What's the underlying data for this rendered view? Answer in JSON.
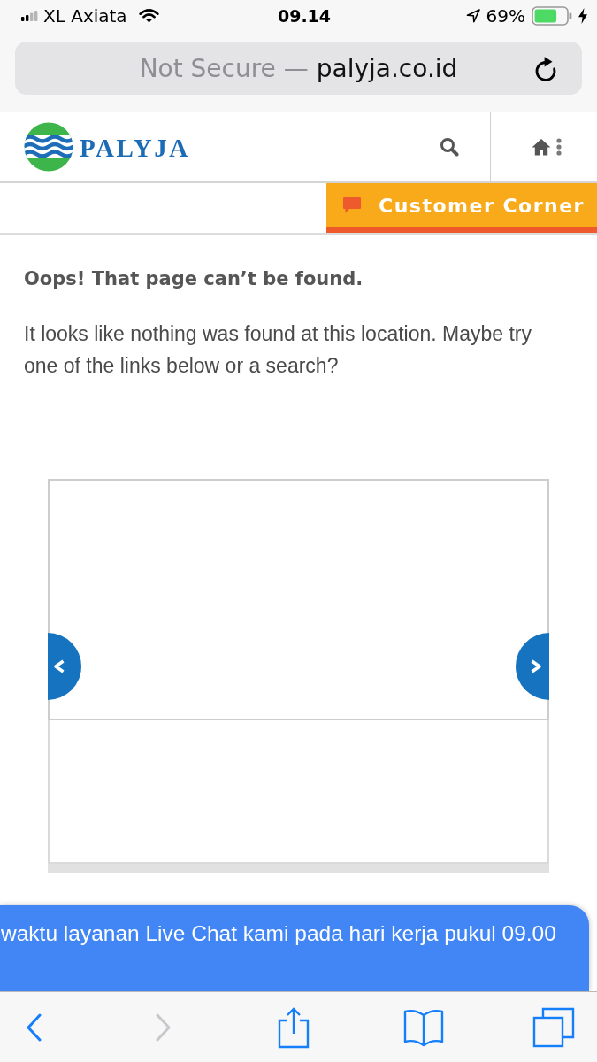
{
  "status_bar": {
    "carrier": "XL Axiata",
    "time": "09.14",
    "battery": "69%"
  },
  "address_bar": {
    "security": "Not Secure —",
    "domain": "palyja.co.id"
  },
  "site_header": {
    "logo_text": "PALYJA"
  },
  "customer_corner": {
    "label": "Customer Corner"
  },
  "error": {
    "title": "Oops! That page can’t be found.",
    "message": "It looks like nothing was found at this location. Maybe try one of the links below or a search?"
  },
  "live_chat": {
    "text": "waktu layanan Live Chat kami pada hari kerja pukul 09.00"
  },
  "toolbar": [
    {
      "kind": "back",
      "disabled": false
    },
    {
      "kind": "forward",
      "disabled": true
    },
    {
      "kind": "share",
      "disabled": false
    },
    {
      "kind": "bookmarks",
      "disabled": false
    },
    {
      "kind": "tabs",
      "disabled": false
    }
  ]
}
